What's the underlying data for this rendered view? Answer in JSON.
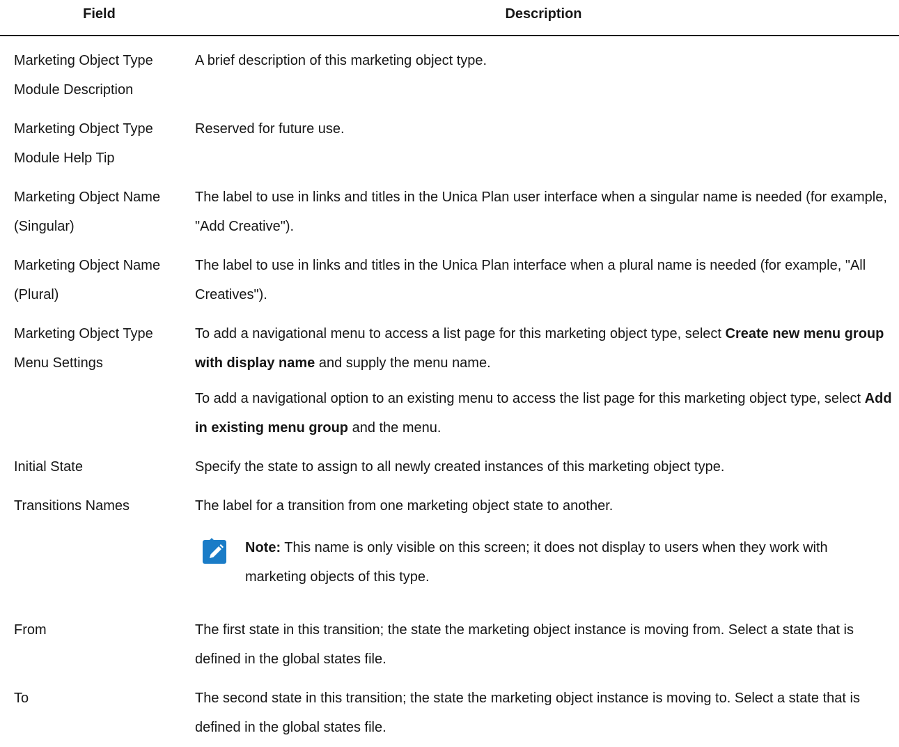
{
  "header": {
    "field": "Field",
    "description": "Description"
  },
  "rows": [
    {
      "field": "Marketing Object Type Module Description",
      "desc": "A brief description of this marketing object type."
    },
    {
      "field": "Marketing Object Type Module Help Tip",
      "desc": "Reserved for future use."
    },
    {
      "field": "Marketing Object Name (Singular)",
      "desc": "The label to use in links and titles in the Unica Plan user interface when a singular name is needed (for example, \"Add Creative\")."
    },
    {
      "field": "Marketing Object Name (Plural)",
      "desc": "The label to use in links and titles in the Unica Plan interface when a plural name is needed (for example, \"All Creatives\")."
    },
    {
      "field": "Marketing Object Type Menu Settings",
      "desc1_pre": "To add a navigational menu to access a list page for this marketing object type, select ",
      "desc1_bold": "Create new menu group with display name",
      "desc1_post": " and supply the menu name.",
      "desc2_pre": "To add a navigational option to an existing menu to access the list page for this marketing object type, select ",
      "desc2_bold": "Add in existing menu group",
      "desc2_post": " and the menu."
    },
    {
      "field": "Initial State",
      "desc": "Specify the state to assign to all newly created instances of this marketing object type."
    },
    {
      "field": "Transitions Names",
      "desc": "The label for a transition from one marketing object state to another.",
      "note_label": "Note:",
      "note_text": " This name is only visible on this screen; it does not display to users when they work with marketing objects of this type."
    },
    {
      "field": "From",
      "desc": "The first state in this transition; the state the marketing object instance is moving from. Select a state that is defined in the global states file."
    },
    {
      "field": "To",
      "desc": "The second state in this transition; the state the marketing object instance is moving to. Select a state that is defined in the global states file."
    }
  ],
  "colors": {
    "note_icon": "#1a7cc7",
    "text": "#161616"
  },
  "icons": {
    "note": "pencil-note-icon"
  }
}
